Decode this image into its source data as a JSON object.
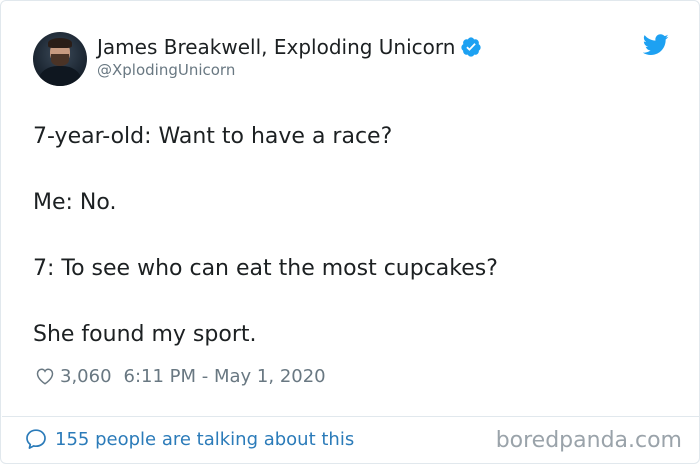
{
  "author": {
    "display_name": "James Breakwell, Exploding Unicorn",
    "handle": "@XplodingUnicorn",
    "verified": true,
    "avatar_icon": "avatar"
  },
  "tweet": {
    "lines": [
      "7-year-old: Want to have a race?",
      "Me: No.",
      "7: To see who can eat the most cupcakes?",
      "She found my sport."
    ]
  },
  "meta": {
    "likes": "3,060",
    "timestamp": "6:11 PM - May 1, 2020"
  },
  "footer": {
    "talking_text": "155 people are talking about this"
  },
  "watermark": "boredpanda.com",
  "colors": {
    "twitter_blue": "#1da1f2",
    "link_blue": "#2b7bb9",
    "muted_text": "#697882",
    "body_text": "#1c2022",
    "border": "#e1e8ed"
  }
}
